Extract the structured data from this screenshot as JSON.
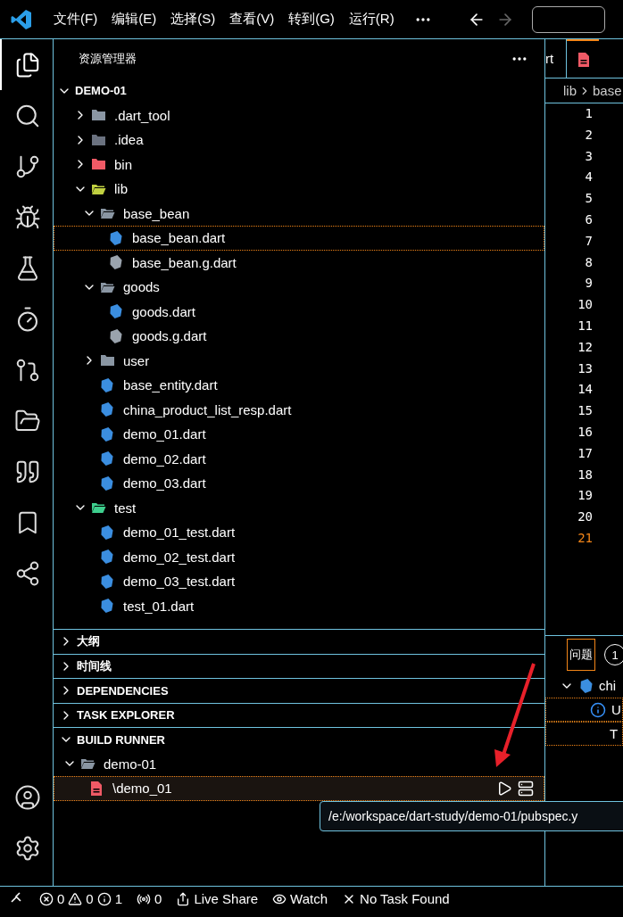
{
  "title_bar": {
    "menu": [
      "文件(F)",
      "编辑(E)",
      "选择(S)",
      "查看(V)",
      "转到(G)",
      "运行(R)"
    ],
    "nav": [
      {
        "kind": "back",
        "disabled": false
      },
      {
        "kind": "forward",
        "disabled": true
      }
    ]
  },
  "activity_bar": [
    {
      "kind": "explorer",
      "selected": true
    },
    {
      "kind": "search",
      "selected": false
    },
    {
      "kind": "source-control",
      "selected": false
    },
    {
      "kind": "run-debug",
      "selected": false
    },
    {
      "kind": "testing",
      "selected": false
    },
    {
      "kind": "timer",
      "selected": false
    },
    {
      "kind": "git-graph",
      "selected": false
    },
    {
      "kind": "folders",
      "selected": false
    },
    {
      "kind": "quote",
      "selected": false
    },
    {
      "kind": "bookmarks",
      "selected": false
    },
    {
      "kind": "live-share",
      "selected": false
    }
  ],
  "activity_bottom": [
    {
      "kind": "account"
    },
    {
      "kind": "settings"
    }
  ],
  "explorer": {
    "title": "资源管理器",
    "root": {
      "label": "DEMO-01",
      "expanded": true,
      "children": [
        {
          "label": ".dart_tool",
          "kind": "folder",
          "color": "#8a96a3",
          "expanded": false
        },
        {
          "label": ".idea",
          "kind": "folder",
          "color": "#6b7280",
          "expanded": false
        },
        {
          "label": "bin",
          "kind": "folder",
          "color": "#f05a66",
          "expanded": false
        },
        {
          "label": "lib",
          "kind": "folder",
          "color": "#c0d040",
          "expanded": true,
          "children": [
            {
              "label": "base_bean",
              "kind": "folder",
              "color": "#8a96a3",
              "expanded": true,
              "children": [
                {
                  "label": "base_bean.dart",
                  "kind": "dart",
                  "selected": true
                },
                {
                  "label": "base_bean.g.dart",
                  "kind": "dart-generated",
                  "selected": false
                }
              ]
            },
            {
              "label": "goods",
              "kind": "folder",
              "color": "#8a96a3",
              "expanded": true,
              "children": [
                {
                  "label": "goods.dart",
                  "kind": "dart",
                  "selected": false
                },
                {
                  "label": "goods.g.dart",
                  "kind": "dart-generated",
                  "selected": false
                }
              ]
            },
            {
              "label": "user",
              "kind": "folder",
              "color": "#8a96a3",
              "expanded": false
            },
            {
              "label": "base_entity.dart",
              "kind": "dart",
              "selected": false
            },
            {
              "label": "china_product_list_resp.dart",
              "kind": "dart",
              "selected": false
            },
            {
              "label": "demo_01.dart",
              "kind": "dart",
              "selected": false
            },
            {
              "label": "demo_02.dart",
              "kind": "dart",
              "selected": false
            },
            {
              "label": "demo_03.dart",
              "kind": "dart",
              "selected": false
            }
          ]
        },
        {
          "label": "test",
          "kind": "folder",
          "color": "#3ecf8e",
          "expanded": true,
          "children": [
            {
              "label": "demo_01_test.dart",
              "kind": "dart",
              "selected": false
            },
            {
              "label": "demo_02_test.dart",
              "kind": "dart",
              "selected": false
            },
            {
              "label": "demo_03_test.dart",
              "kind": "dart",
              "selected": false
            },
            {
              "label": "test_01.dart",
              "kind": "dart",
              "selected": false
            }
          ]
        }
      ]
    }
  },
  "sections": [
    {
      "label": "大纲",
      "expanded": false
    },
    {
      "label": "时间线",
      "expanded": false
    },
    {
      "label": "DEPENDENCIES",
      "expanded": false
    },
    {
      "label": "TASK EXPLORER",
      "expanded": false
    },
    {
      "label": "BUILD RUNNER",
      "expanded": true,
      "children": [
        {
          "label": "demo-01",
          "kind": "folder",
          "color": "#8a96a3",
          "expanded": true,
          "children": [
            {
              "label": "\\demo_01",
              "kind": "pubspec",
              "selected": true
            }
          ]
        }
      ]
    }
  ],
  "tooltip": "/e:/workspace/dart-study/demo-01/pubspec.y",
  "editor": {
    "tabs": [
      {
        "label": "rt",
        "selected": false
      },
      {
        "kind": "pubspec",
        "selected": true
      }
    ],
    "breadcrumb": [
      "lib",
      "base"
    ],
    "lines": [
      {
        "n": "1",
        "current": false
      },
      {
        "n": "2",
        "current": false
      },
      {
        "n": "3",
        "current": false
      },
      {
        "n": "4",
        "current": false
      },
      {
        "n": "5",
        "current": false
      },
      {
        "n": "6",
        "current": false
      },
      {
        "n": "7",
        "current": false
      },
      {
        "n": "8",
        "current": false
      },
      {
        "n": "9",
        "current": false
      },
      {
        "n": "10",
        "current": false
      },
      {
        "n": "11",
        "current": false
      },
      {
        "n": "12",
        "current": false
      },
      {
        "n": "13",
        "current": false
      },
      {
        "n": "14",
        "current": false
      },
      {
        "n": "15",
        "current": false
      },
      {
        "n": "16",
        "current": false
      },
      {
        "n": "17",
        "current": false
      },
      {
        "n": "18",
        "current": false
      },
      {
        "n": "19",
        "current": false
      },
      {
        "n": "20",
        "current": false
      },
      {
        "n": "21",
        "current": true
      }
    ]
  },
  "panel": {
    "tabs": [
      {
        "label": "问题",
        "selected": true,
        "badge": "1"
      }
    ],
    "rows": [
      {
        "kind": "file",
        "label": "chi",
        "expanded": true,
        "focused": false
      },
      {
        "kind": "info",
        "label": "U",
        "focused": true
      },
      {
        "kind": "text",
        "label": "T",
        "focused": true
      }
    ]
  },
  "status_bar": [
    {
      "kind": "remote"
    },
    {
      "kind": "problems",
      "errors": "0",
      "warnings": "0",
      "infos": "1"
    },
    {
      "kind": "ports",
      "label": "0"
    },
    {
      "kind": "live-share",
      "label": "Live Share"
    },
    {
      "kind": "watch",
      "label": "Watch"
    },
    {
      "kind": "tasks",
      "label": "No Task Found"
    }
  ]
}
